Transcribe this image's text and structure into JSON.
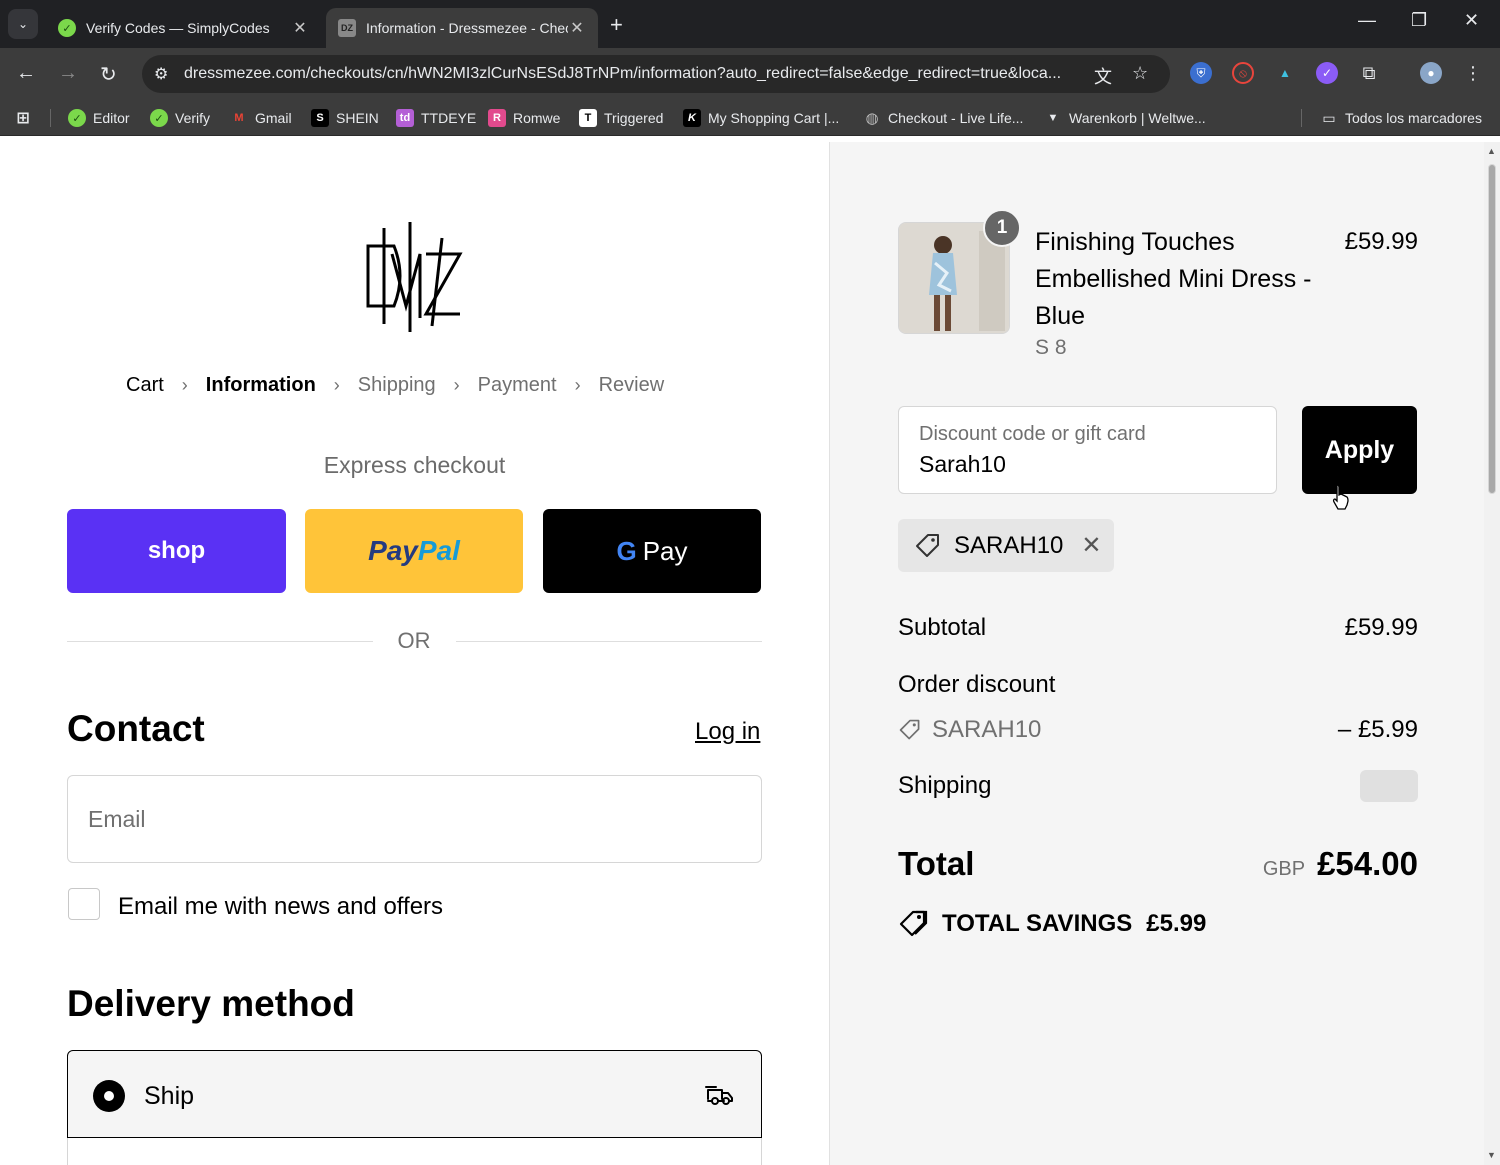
{
  "browser": {
    "tabs": [
      {
        "title": "Verify Codes — SimplyCodes",
        "icon": "simplycodes-icon"
      },
      {
        "title": "Information - Dressmezee - Checkout",
        "icon": "dressmezee-icon"
      }
    ],
    "url": "dressmezee.com/checkouts/cn/hWN2MI3zlCurNsESdJ8TrNPm/information?auto_redirect=false&edge_redirect=true&loca...",
    "bookmarks": [
      {
        "label": "Editor",
        "icon": "simplycodes-icon",
        "color": "#7bd84b"
      },
      {
        "label": "Verify",
        "icon": "simplycodes-icon",
        "color": "#7bd84b"
      },
      {
        "label": "Gmail",
        "icon": "gmail-icon",
        "color": "#ea4335"
      },
      {
        "label": "SHEIN",
        "icon": "shein-icon",
        "color": "#000000"
      },
      {
        "label": "TTDEYE",
        "icon": "ttdeye-icon",
        "color": "#b45fd6"
      },
      {
        "label": "Romwe",
        "icon": "romwe-icon",
        "color": "#e24a8d"
      },
      {
        "label": "Triggered",
        "icon": "triggered-icon",
        "color": "#ffffff"
      },
      {
        "label": "My Shopping Cart |...",
        "icon": "k-icon",
        "color": "#000000"
      },
      {
        "label": "Checkout - Live Life...",
        "icon": "globe-icon",
        "color": "#bbbbbb"
      },
      {
        "label": "Warenkorb | Weltwe...",
        "icon": "v-icon",
        "color": "#000000"
      }
    ],
    "all_bookmarks": "Todos los marcadores"
  },
  "checkout": {
    "breadcrumb": [
      "Cart",
      "Information",
      "Shipping",
      "Payment",
      "Review"
    ],
    "express_title": "Express checkout",
    "express_buttons": {
      "shop": "shop",
      "paypal_a": "Pay",
      "paypal_b": "Pal",
      "gpay_g": "G",
      "gpay": "Pay"
    },
    "or": "OR",
    "contact": {
      "heading": "Contact",
      "login": "Log in",
      "email_placeholder": "Email",
      "email_value": "",
      "newsletter": "Email me with news and offers",
      "newsletter_checked": false
    },
    "delivery": {
      "heading": "Delivery method",
      "selected": "Ship"
    }
  },
  "summary": {
    "product": {
      "name": "Finishing Touches Embellished Mini Dress - Blue",
      "variant": "S 8",
      "price": "£59.99",
      "quantity": "1"
    },
    "discount": {
      "placeholder": "Discount code or gift card",
      "value": "Sarah10",
      "apply": "Apply",
      "applied_code": "SARAH10"
    },
    "subtotal_label": "Subtotal",
    "subtotal": "£59.99",
    "order_discount_label": "Order discount",
    "order_discount_code": "SARAH10",
    "order_discount_value": "– £5.99",
    "shipping_label": "Shipping",
    "total_label": "Total",
    "currency": "GBP",
    "total": "£54.00",
    "savings_label": "TOTAL SAVINGS",
    "savings": "£5.99"
  },
  "colors": {
    "shop": "#5a31f4",
    "paypal": "#ffc439",
    "gpay": "#000000",
    "apply": "#000000"
  }
}
